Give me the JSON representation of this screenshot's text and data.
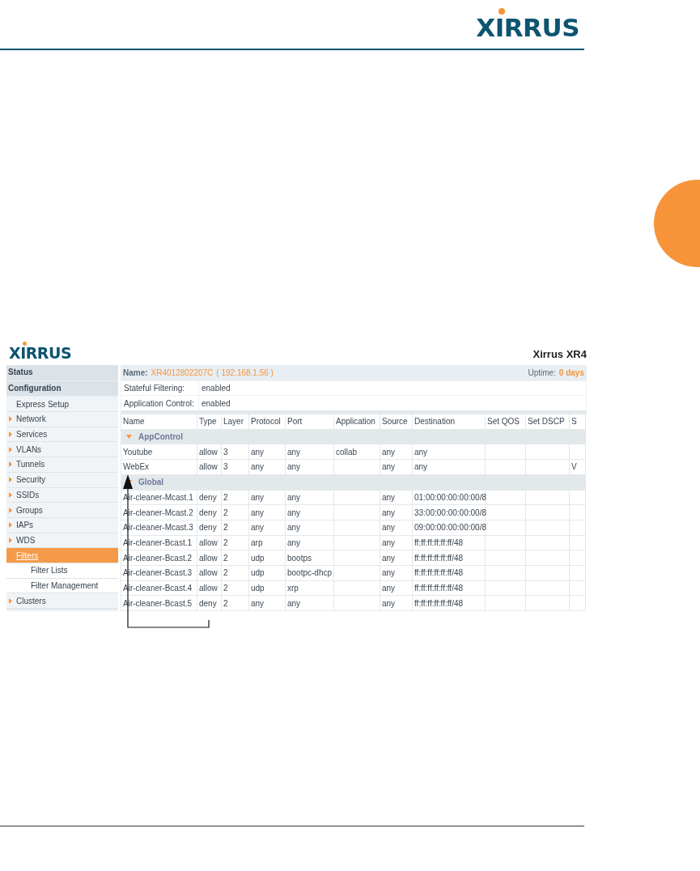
{
  "header": {
    "logo": "XIRRUS"
  },
  "screenshot": {
    "logo": "XIRRUS",
    "title": "Xirrus XR4",
    "sidebar": [
      {
        "label": "Status",
        "kind": "section",
        "selected": false
      },
      {
        "label": "Configuration",
        "kind": "section",
        "selected": false
      },
      {
        "label": "Express Setup",
        "kind": "link",
        "selected": false
      },
      {
        "label": "Network",
        "kind": "group",
        "selected": false
      },
      {
        "label": "Services",
        "kind": "group",
        "selected": false
      },
      {
        "label": "VLANs",
        "kind": "group",
        "selected": false
      },
      {
        "label": "Tunnels",
        "kind": "group",
        "selected": false
      },
      {
        "label": "Security",
        "kind": "group",
        "selected": false
      },
      {
        "label": "SSIDs",
        "kind": "group",
        "selected": false
      },
      {
        "label": "Groups",
        "kind": "group",
        "selected": false
      },
      {
        "label": "IAPs",
        "kind": "group",
        "selected": false
      },
      {
        "label": "WDS",
        "kind": "group",
        "selected": false
      },
      {
        "label": "Filters",
        "kind": "group",
        "selected": true,
        "children": [
          {
            "label": "Filter Lists",
            "selected": false
          },
          {
            "label": "Filter Management",
            "selected": false
          }
        ]
      },
      {
        "label": "Clusters",
        "kind": "group",
        "selected": false
      }
    ],
    "name_bar": {
      "label": "Name:",
      "name": "XR4012802207C",
      "ip": "( 192.168.1.56 )",
      "uptime_label": "Uptime:",
      "uptime": "0 days"
    },
    "settings": [
      {
        "label": "Stateful Filtering:",
        "value": "enabled"
      },
      {
        "label": "Application Control:",
        "value": "enabled"
      }
    ],
    "table": {
      "columns": [
        "Name",
        "Type",
        "Layer",
        "Protocol",
        "Port",
        "Application",
        "Source",
        "Destination",
        "Set QOS",
        "Set DSCP",
        "S"
      ],
      "groups": [
        {
          "name": "AppControl",
          "expanded": true,
          "rows": [
            [
              "Youtube",
              "allow",
              "3",
              "any",
              "any",
              "collab",
              "any",
              "any",
              null,
              null,
              null
            ],
            [
              "WebEx",
              "allow",
              "3",
              "any",
              "any",
              null,
              "any",
              "any",
              null,
              null,
              "V"
            ]
          ]
        },
        {
          "name": "Global",
          "expanded": true,
          "rows": [
            [
              "Air-cleaner-Mcast.1",
              "deny",
              "2",
              "any",
              "any",
              null,
              "any",
              "01:00:00:00:00:00/8",
              null,
              null,
              null
            ],
            [
              "Air-cleaner-Mcast.2",
              "deny",
              "2",
              "any",
              "any",
              null,
              "any",
              "33:00:00:00:00:00/8",
              null,
              null,
              null
            ],
            [
              "Air-cleaner-Mcast.3",
              "deny",
              "2",
              "any",
              "any",
              null,
              "any",
              "09:00:00:00:00:00/8",
              null,
              null,
              null
            ],
            [
              "Air-cleaner-Bcast.1",
              "allow",
              "2",
              "arp",
              "any",
              null,
              "any",
              "ff:ff:ff:ff:ff:ff/48",
              null,
              null,
              null
            ],
            [
              "Air-cleaner-Bcast.2",
              "allow",
              "2",
              "udp",
              "bootps",
              null,
              "any",
              "ff:ff:ff:ff:ff:ff/48",
              null,
              null,
              null
            ],
            [
              "Air-cleaner-Bcast.3",
              "allow",
              "2",
              "udp",
              "bootpc-dhcp",
              null,
              "any",
              "ff:ff:ff:ff:ff:ff/48",
              null,
              null,
              null
            ],
            [
              "Air-cleaner-Bcast.4",
              "allow",
              "2",
              "udp",
              "xrp",
              null,
              "any",
              "ff:ff:ff:ff:ff:ff/48",
              null,
              null,
              null
            ],
            [
              "Air-cleaner-Bcast.5",
              "deny",
              "2",
              "any",
              "any",
              null,
              "any",
              "ff:ff:ff:ff:ff:ff/48",
              null,
              null,
              null
            ]
          ]
        }
      ]
    }
  }
}
